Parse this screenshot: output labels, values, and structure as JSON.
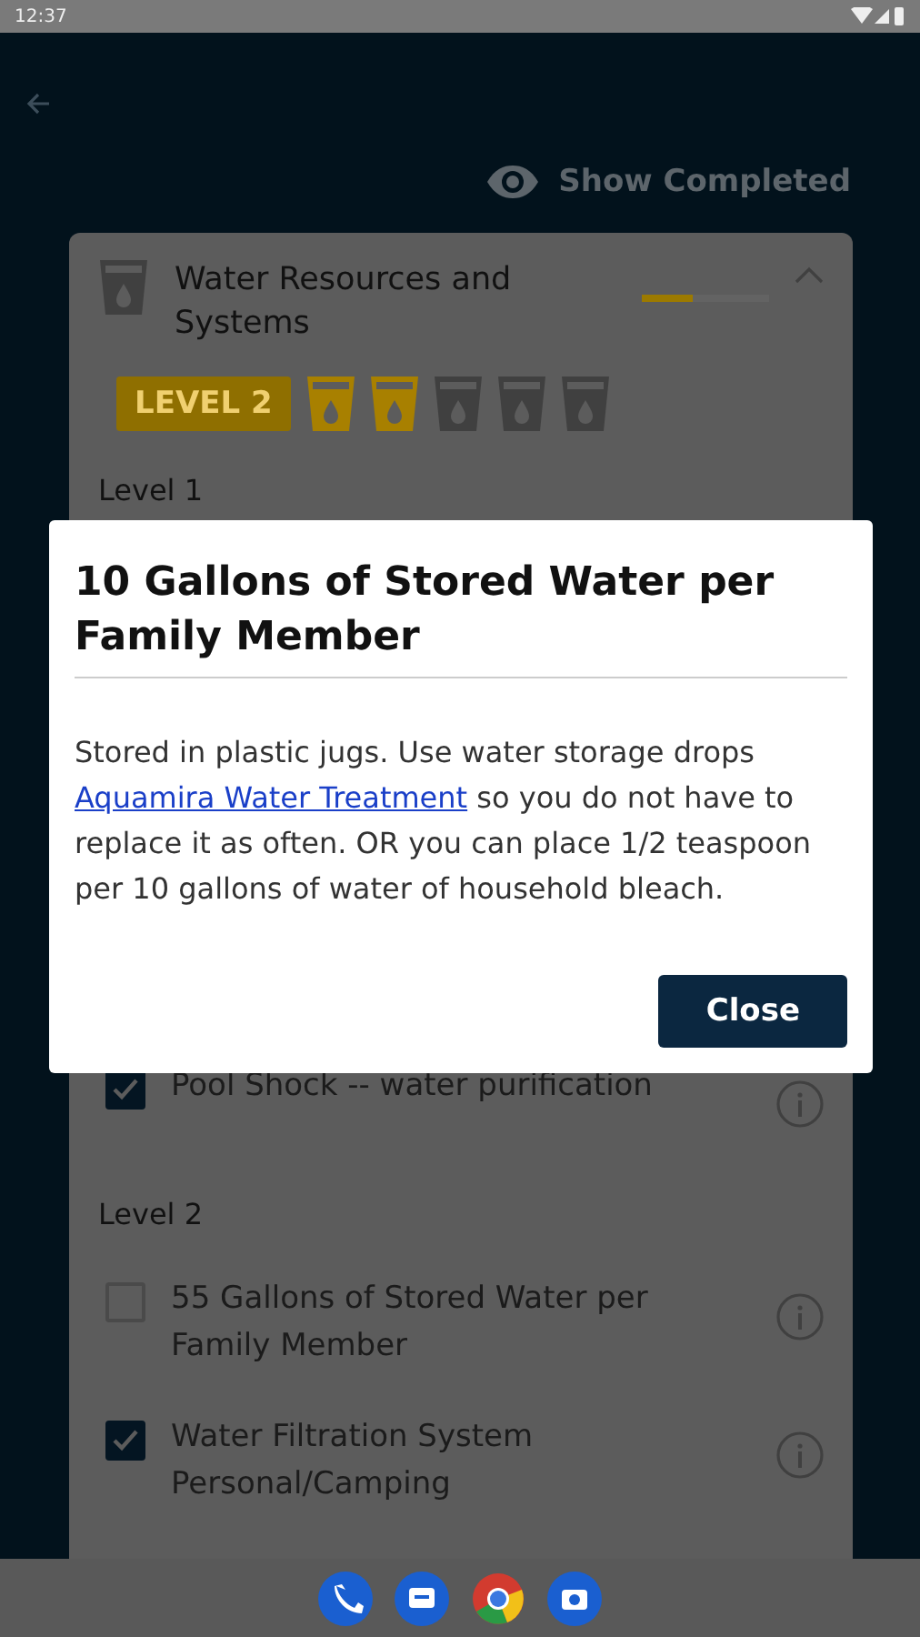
{
  "status_bar": {
    "time": "12:37"
  },
  "header": {
    "show_completed": "Show Completed"
  },
  "category": {
    "title": "Water Resources and Systems",
    "expanded": true,
    "level": 0.4,
    "badge": "LEVEL 2",
    "stars": 2
  },
  "sections": [
    {
      "title": "Level 1",
      "items": [
        {
          "label": "Pool Shock -- water purification",
          "checked": true
        }
      ]
    },
    {
      "title": "Level 2",
      "items": [
        {
          "label": "55 Gallons of Stored Water per Family Member",
          "checked": false
        },
        {
          "label": "Water Filtration System Personal/Camping",
          "checked": true
        }
      ]
    }
  ],
  "dialog": {
    "title": "10 Gallons of Stored Water per Family Member",
    "body_before": "Stored in plastic jugs. Use water storage drops",
    "link": "Aquamira Water Treatment",
    "body_after": "so you do not have to replace it as often. OR you can place 1/2 teaspoon per 10 gallons of water of household bleach.",
    "button": "Close"
  }
}
